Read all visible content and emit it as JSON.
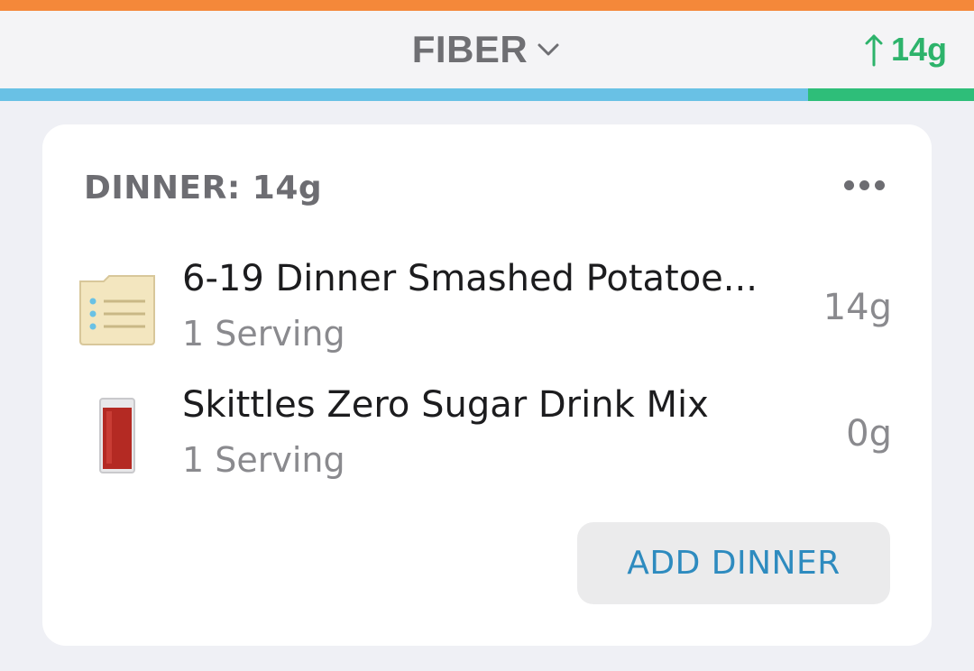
{
  "header": {
    "nutrient": "FIBER",
    "trend_value": "14g",
    "progress_fraction": 0.83,
    "colors": {
      "top_strip": "#f4883a",
      "progress_fill": "#69c1e5",
      "progress_remaining": "#2ebe79",
      "trend": "#2db36b"
    }
  },
  "meal": {
    "title": "DINNER: 14g",
    "more_icon": "more-horizontal-icon",
    "items": [
      {
        "name": "6-19 Dinner Smashed Potatoe...",
        "serving": "1 Serving",
        "amount": "14g",
        "icon": "recipe-list-icon"
      },
      {
        "name": "Skittles Zero Sugar Drink Mix",
        "serving": "1 Serving",
        "amount": "0g",
        "icon": "drink-glass-icon"
      }
    ],
    "add_label": "ADD DINNER"
  }
}
